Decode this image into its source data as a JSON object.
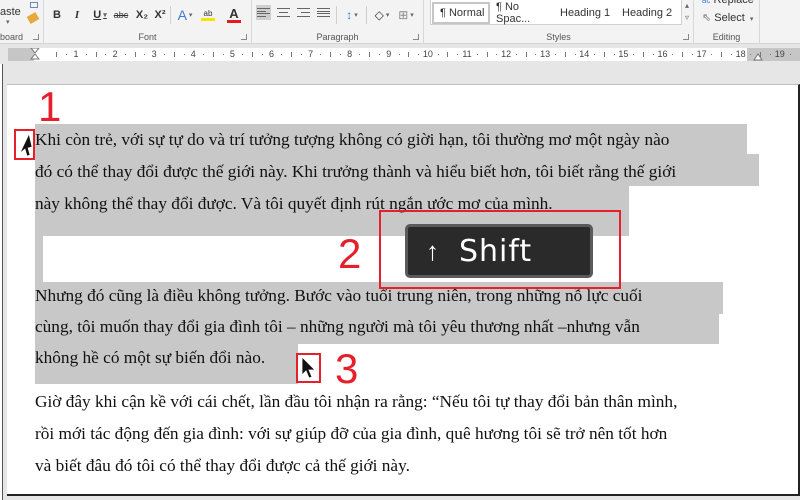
{
  "ribbon": {
    "clipboard": {
      "paste_label": "aste",
      "group_label": "board"
    },
    "font": {
      "group_label": "Font",
      "bold": "B",
      "italic": "I",
      "underline": "U",
      "strikethrough": "abc",
      "subscript": "X₂",
      "superscript": "X²",
      "text_effects": "A",
      "highlight": "ab",
      "font_color": "A",
      "highlight_color": "#f5e400",
      "font_color_bar": "#e41b1b"
    },
    "paragraph": {
      "group_label": "Paragraph"
    },
    "styles": {
      "group_label": "Styles",
      "items": [
        {
          "label": "¶ Normal",
          "active": true
        },
        {
          "label": "¶ No Spac..."
        },
        {
          "label": "Heading 1"
        },
        {
          "label": "Heading 2"
        }
      ]
    },
    "editing": {
      "group_label": "Editing",
      "replace_label": "Replace",
      "select_label": "Select"
    }
  },
  "ruler": {
    "numbers": [
      "1",
      "2",
      "3",
      "4",
      "5",
      "6",
      "7",
      "8",
      "9",
      "10",
      "11",
      "12",
      "13",
      "14",
      "15",
      "16",
      "17",
      "18",
      "19"
    ]
  },
  "document": {
    "paragraphs": [
      {
        "selected": true,
        "lines": [
          "Khi còn trẻ, với sự tự do và trí tưởng tượng không có giời hạn, tôi thường mơ một ngày nào",
          "đó có thể thay đổi được thế giới này. Khi trưởng thành và hiểu biết hơn, tôi biết rằng thế giới",
          "này không thể thay đổi được. Và tôi quyết định rút ngắn ước mơ của mình."
        ]
      },
      {
        "selected": true,
        "lines": [
          "Nhưng đó cũng là điều không tưởng. Bước vào tuổi trung niên, trong những nỗ lực cuối",
          "cùng, tôi muốn thay đổi gia đình tôi – những người mà tôi yêu thương nhất –nhưng vẫn",
          "không hề có một sự biến đổi nào."
        ]
      },
      {
        "selected": false,
        "lines": [
          "Giờ đây khi cận kề với cái chết, lần đầu tôi nhận ra rằng: “Nếu tôi tự thay đổi bản thân mình,",
          "rồi mới tác động đến gia đình: với sự giúp đỡ của gia đình, quê hương tôi sẽ trở nên tốt hơn",
          "và biết đâu đó tôi có thể thay đổi được cả thế giới này."
        ]
      }
    ]
  },
  "annotations": {
    "step1": "1",
    "step2": "2",
    "step3": "3",
    "shift_key": {
      "arrow": "↑",
      "label": "Shift"
    },
    "accent_color": "#e5202a"
  }
}
